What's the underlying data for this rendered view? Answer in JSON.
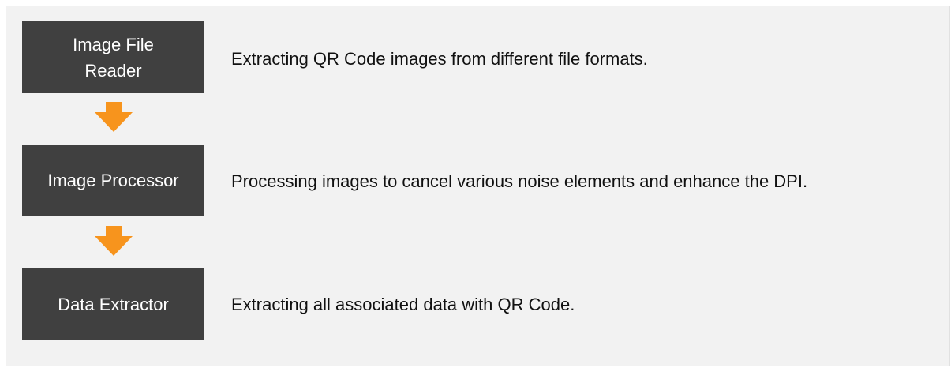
{
  "colors": {
    "box_fill": "#404040",
    "box_text": "#ffffff",
    "arrow": "#f7941d",
    "panel_bg": "#f2f2f2"
  },
  "steps": [
    {
      "label": "Image File Reader",
      "description": "Extracting QR Code images from different file formats."
    },
    {
      "label": "Image Processor",
      "description": "Processing images to cancel various noise elements and enhance the DPI."
    },
    {
      "label": "Data Extractor",
      "description": "Extracting all associated data with QR Code."
    }
  ],
  "connectors": [
    {
      "icon": "down-arrow-icon"
    },
    {
      "icon": "down-arrow-icon"
    }
  ]
}
